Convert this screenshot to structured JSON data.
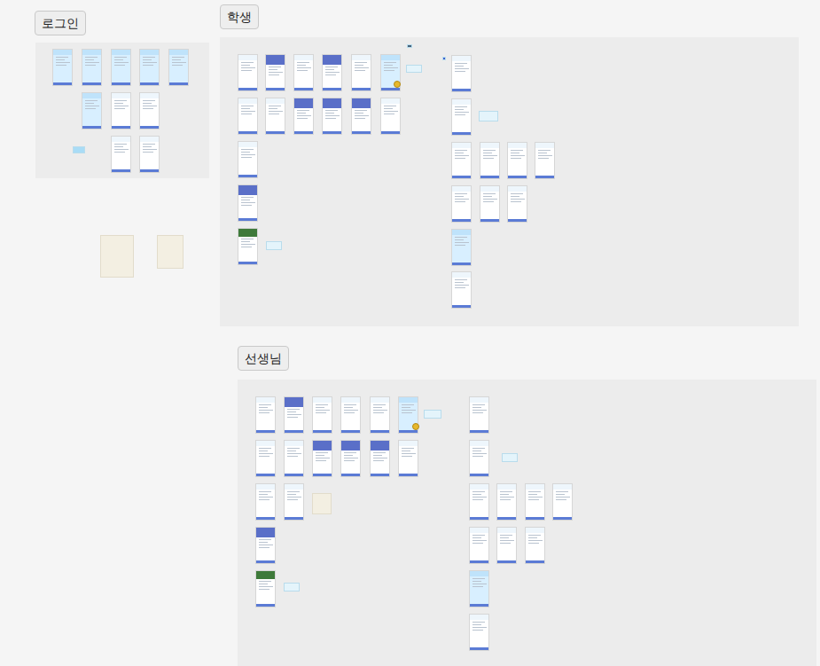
{
  "sections": [
    {
      "title": "로그인"
    },
    {
      "title": "학생"
    },
    {
      "title": "선생님"
    }
  ]
}
